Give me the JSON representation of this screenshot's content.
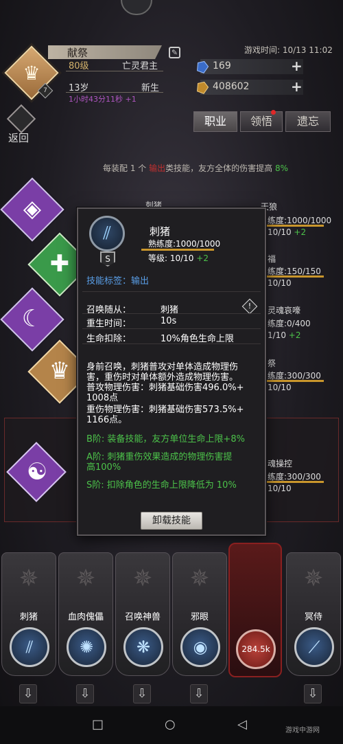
{
  "header": {
    "player_name": "献祭",
    "level": "80级",
    "class_name": "亡灵君主",
    "age": "13岁",
    "status": "新生",
    "play_time_bonus": "1小时43分11秒 +1",
    "portrait_badge": "7",
    "game_time": "游戏时间: 10/13 11:02"
  },
  "resources": {
    "gem": "169",
    "gold": "408602"
  },
  "tabs": [
    "职业",
    "领悟",
    "遗忘"
  ],
  "back_label": "返回",
  "info": {
    "prefix": "每装配 1 个",
    "highlight": "输出",
    "middle": "类技能，友方全体的伤害提高",
    "percent": "8%"
  },
  "background_rows": [
    {
      "name": "刺猪",
      "text": ""
    },
    {
      "name": "天狼",
      "prof": "练度:1000/1000",
      "lvl": "10/10",
      "bonus": "+2"
    },
    {
      "name": "",
      "prof": "",
      "lvl": "10/10",
      "bonus": "+2"
    },
    {
      "name": "福",
      "prof": "练度:150/150",
      "lvl": "10/10",
      "bonus": ""
    },
    {
      "name": "灵魂哀嚎",
      "prof": "练度:0/400",
      "lvl": "1/10",
      "bonus": "+2"
    },
    {
      "name": "祭",
      "prof": "练度:300/300",
      "lvl": "10/10",
      "bonus": ""
    },
    {
      "name": "魂操控",
      "prof": "练度:300/300",
      "lvl": "10/10",
      "bonus": ""
    }
  ],
  "panel": {
    "skill_name": "刺猪",
    "grade": "S",
    "proficiency": "熟练度:1000/1000",
    "level_label": "等级: 10/10",
    "level_bonus": "+2",
    "tag": "技能标签：输出",
    "rows": [
      {
        "label": "召唤随从：",
        "value": "刺猪"
      },
      {
        "label": "重生时间：",
        "value": "10s"
      },
      {
        "label": "生命扣除：",
        "value": "10%角色生命上限"
      }
    ],
    "desc": [
      "身前召唤，刺猪普攻对单体造成物理伤",
      "害，重伤时对单体额外造成物理伤害。",
      "普攻物理伤害：刺猪基础伤害496.0%+",
      "1008点",
      "重伤物理伤害：刺猪基础伤害573.5%+",
      "1166点。"
    ],
    "bonus_b": "B阶: 装备技能，友方单位生命上限+8%",
    "bonus_a1": "A阶: 刺猪重伤效果造成的物理伤害提",
    "bonus_a2": "高100%",
    "bonus_s": "S阶: 扣除角色的生命上限降低为 10%",
    "unload_label": "卸载技能"
  },
  "cards": [
    {
      "label": "刺猪",
      "icon": "claw-icon"
    },
    {
      "label": "血肉傀儡",
      "icon": "burst-icon"
    },
    {
      "label": "召唤神兽",
      "icon": "beast-icon"
    },
    {
      "label": "邪眼",
      "icon": "eye-icon"
    },
    {
      "label": "冥侍",
      "icon": "slash-icon"
    }
  ],
  "special_card": {
    "value": "284.5k"
  },
  "watermark": "游戏中游网",
  "colors": {
    "accent_gold": "#c9962c",
    "bonus_green": "#4cc24a",
    "tag_blue": "#5a9fe8",
    "highlight_red": "#c23030"
  }
}
